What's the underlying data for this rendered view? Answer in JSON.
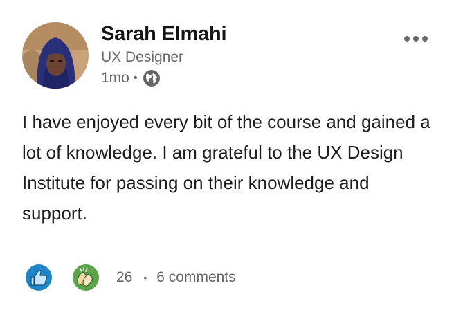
{
  "post": {
    "author": {
      "name": "Sarah Elmahi",
      "title": "UX Designer",
      "avatar_icon": "profile-photo"
    },
    "meta": {
      "time_ago": "1mo",
      "separator": "•",
      "visibility_icon": "globe-icon"
    },
    "more_icon": "ellipsis-icon",
    "text": "I have enjoyed every bit of the course and gained a lot of knowledge. I am grateful to the UX Design Institute for passing on their knowledge and support.",
    "social": {
      "reactions": [
        "like-icon",
        "celebrate-icon"
      ],
      "reaction_count": "26",
      "separator": "•",
      "comments": "6 comments"
    },
    "colors": {
      "like": "#1e86c8",
      "celebrate": "#5aa54a",
      "secondary_text": "#666666"
    }
  }
}
